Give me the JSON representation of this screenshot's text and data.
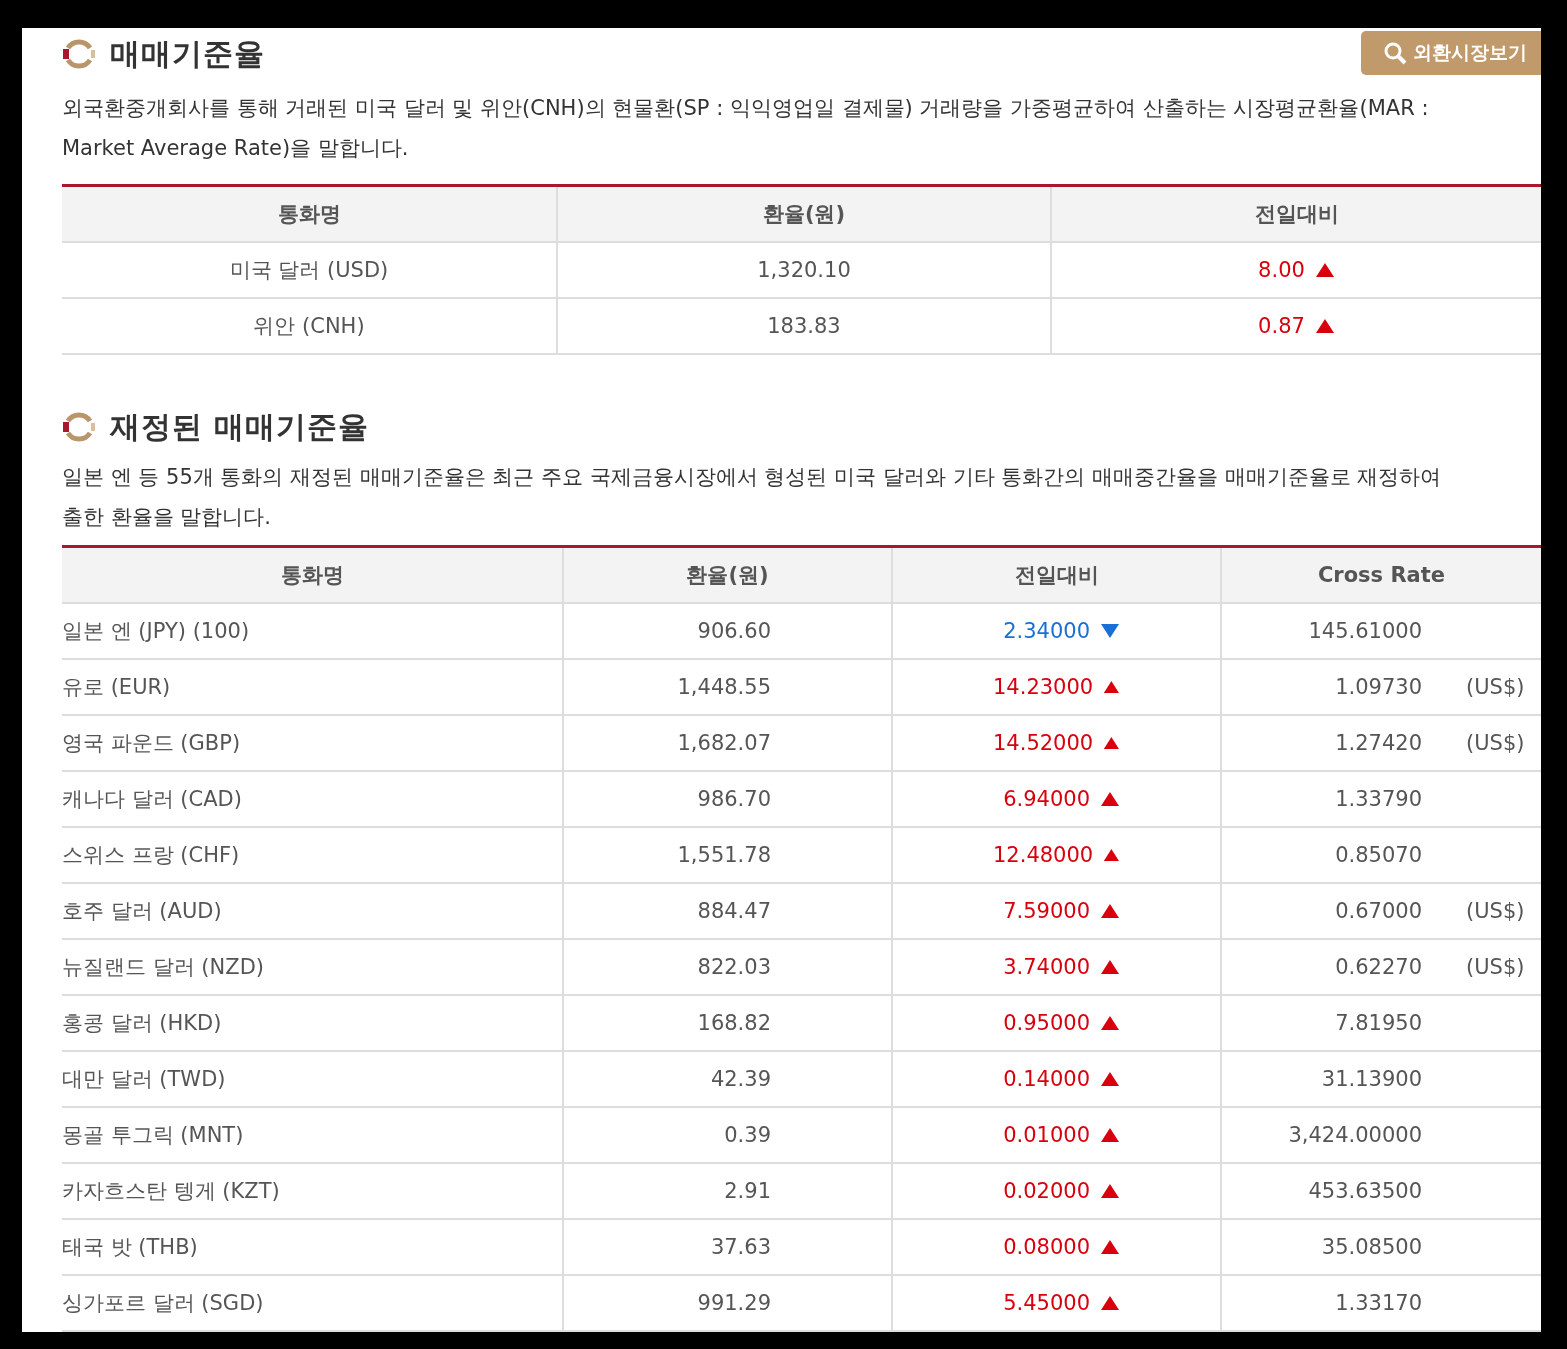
{
  "sections": [
    {
      "title": "매매기준율",
      "button": "외환시장보기",
      "description": "외국환중개회사를 통해 거래된 미국 달러 및 위안(CNH)의 현물환(SP : 익익영업일 결제물) 거래량을 가중평균하여 산출하는 시장평균환율(MAR : Market Average Rate)을 말합니다.",
      "table": {
        "columns": [
          "통화명",
          "환율(원)",
          "전일대비"
        ],
        "rows": [
          {
            "name": "미국 달러 (USD)",
            "rate": "1,320.10",
            "change": "8.00",
            "rising": true
          },
          {
            "name": "위안 (CNH)",
            "rate": "183.83",
            "change": "0.87",
            "rising": true
          }
        ]
      }
    },
    {
      "title": "재정된 매매기준율",
      "description_lines": [
        "일본 엔 등 55개 통화의 재정된 매매기준율은 최근 주요 국제금융시장에서 형성된 미국 달러와 기타 통화간의 매매중간율을 매매기준율로 재정하여",
        "출한 환율을 말합니다."
      ],
      "table": {
        "columns": [
          "통화명",
          "환율(원)",
          "전일대비",
          "Cross Rate"
        ],
        "rows": [
          {
            "name": "일본 엔 (JPY) (100)",
            "rate": "906.60",
            "change": "2.34000",
            "rising": false,
            "cross": "145.61000"
          },
          {
            "name": "유로 (EUR)",
            "rate": "1,448.55",
            "change": "14.23000",
            "rising": true,
            "cross": "1.09730",
            "unit": "(US$)"
          },
          {
            "name": "영국 파운드 (GBP)",
            "rate": "1,682.07",
            "change": "14.52000",
            "rising": true,
            "cross": "1.27420",
            "unit": "(US$)"
          },
          {
            "name": "캐나다 달러 (CAD)",
            "rate": "986.70",
            "change": "6.94000",
            "rising": true,
            "cross": "1.33790"
          },
          {
            "name": "스위스 프랑 (CHF)",
            "rate": "1,551.78",
            "change": "12.48000",
            "rising": true,
            "cross": "0.85070"
          },
          {
            "name": "호주 달러 (AUD)",
            "rate": "884.47",
            "change": "7.59000",
            "rising": true,
            "cross": "0.67000",
            "unit": "(US$)"
          },
          {
            "name": "뉴질랜드 달러 (NZD)",
            "rate": "822.03",
            "change": "3.74000",
            "rising": true,
            "cross": "0.62270",
            "unit": "(US$)"
          },
          {
            "name": "홍콩 달러 (HKD)",
            "rate": "168.82",
            "change": "0.95000",
            "rising": true,
            "cross": "7.81950"
          },
          {
            "name": "대만 달러 (TWD)",
            "rate": "42.39",
            "change": "0.14000",
            "rising": true,
            "cross": "31.13900"
          },
          {
            "name": "몽골 투그릭 (MNT)",
            "rate": "0.39",
            "change": "0.01000",
            "rising": true,
            "cross": "3,424.00000"
          },
          {
            "name": "카자흐스탄 텡게 (KZT)",
            "rate": "2.91",
            "change": "0.02000",
            "rising": true,
            "cross": "453.63500"
          },
          {
            "name": "태국 밧 (THB)",
            "rate": "37.63",
            "change": "0.08000",
            "rising": true,
            "cross": "35.08500"
          },
          {
            "name": "싱가포르 달러 (SGD)",
            "rate": "991.29",
            "change": "5.45000",
            "rising": true,
            "cross": "1.33170"
          }
        ]
      }
    }
  ]
}
